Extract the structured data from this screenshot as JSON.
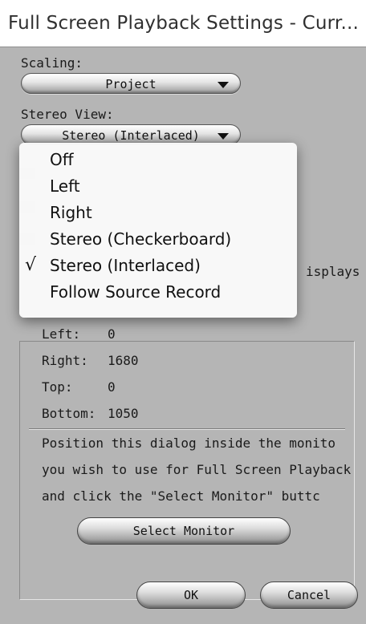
{
  "window": {
    "title": "Full Screen Playback Settings - Curr..."
  },
  "scaling": {
    "label": "Scaling:",
    "value": "Project"
  },
  "stereo_view": {
    "label": "Stereo View:",
    "value": "Stereo (Interlaced)",
    "options": [
      {
        "label": "Off",
        "checked": false
      },
      {
        "label": "Left",
        "checked": false
      },
      {
        "label": "Right",
        "checked": false
      },
      {
        "label": "Stereo (Checkerboard)",
        "checked": false
      },
      {
        "label": "Stereo (Interlaced)",
        "checked": true
      },
      {
        "label": "Follow Source Record",
        "checked": false
      }
    ],
    "check_mark": "√"
  },
  "partial_label": "isplays",
  "monitor": {
    "rows": [
      {
        "label": "Left:",
        "value": "0"
      },
      {
        "label": "Right:",
        "value": "1680"
      },
      {
        "label": "Top:",
        "value": "0"
      },
      {
        "label": "Bottom:",
        "value": "1050"
      }
    ],
    "instructions": [
      "Position this dialog inside the monito",
      "you wish to use for Full Screen Playback",
      "and click the \"Select Monitor\" buttc"
    ],
    "select_button": "Select Monitor"
  },
  "buttons": {
    "ok": "OK",
    "cancel": "Cancel"
  }
}
